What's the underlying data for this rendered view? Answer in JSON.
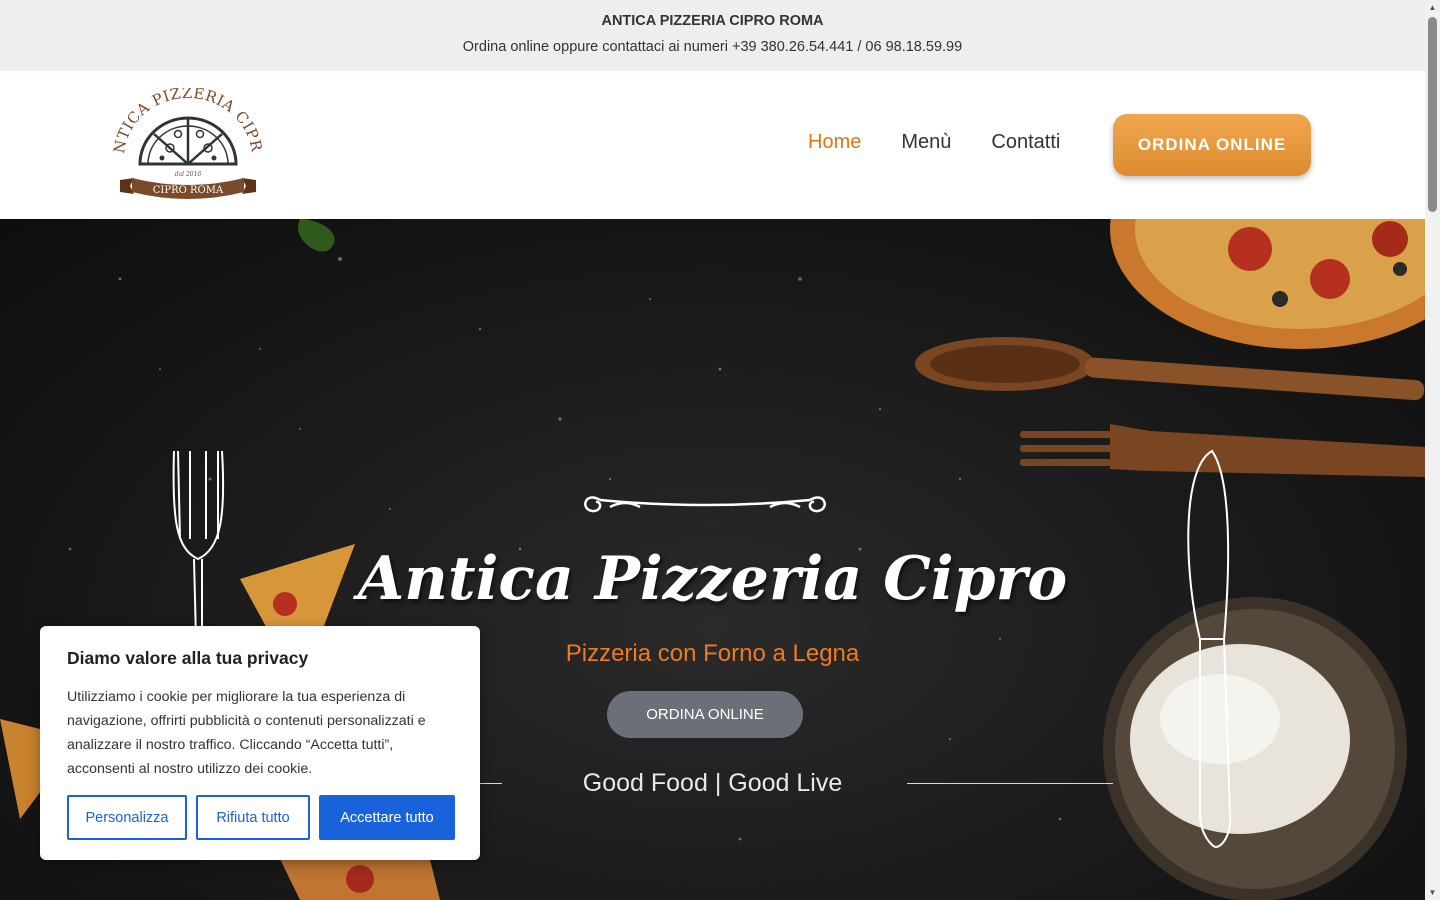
{
  "topbar": {
    "title": "ANTICA PIZZERIA CIPRO ROMA",
    "contact": "Ordina online oppure contattaci ai numeri +39 380.26.54.441 / 06 98.18.59.99"
  },
  "header": {
    "logo": {
      "top_text": "ANTICA PIZZERIA CIPRO",
      "est": "dal 2016",
      "ribbon": "CIPRO ROMA"
    },
    "nav": [
      {
        "label": "Home",
        "active": true
      },
      {
        "label": "Menù",
        "active": false
      },
      {
        "label": "Contatti",
        "active": false
      }
    ],
    "order_button": "ORDINA ONLINE"
  },
  "hero": {
    "title": "Antica Pizzeria Cipro",
    "subtitle": "Pizzeria con Forno a Legna",
    "button": "ORDINA ONLINE",
    "tagline": "Good Food | Good Live"
  },
  "cookie": {
    "title": "Diamo valore alla tua privacy",
    "text": "Utilizziamo i cookie per migliorare la tua esperienza di navigazione, offrirti pubblicità o contenuti personalizzati e analizzare il nostro traffico. Cliccando “Accetta tutti”, acconsenti al nostro utilizzo dei cookie.",
    "buttons": {
      "customize": "Personalizza",
      "reject": "Rifiuta tutto",
      "accept": "Accettare tutto"
    }
  },
  "colors": {
    "accent": "#e2741a",
    "cookie_blue": "#1863dc",
    "hero_button": "#6b6f78"
  }
}
